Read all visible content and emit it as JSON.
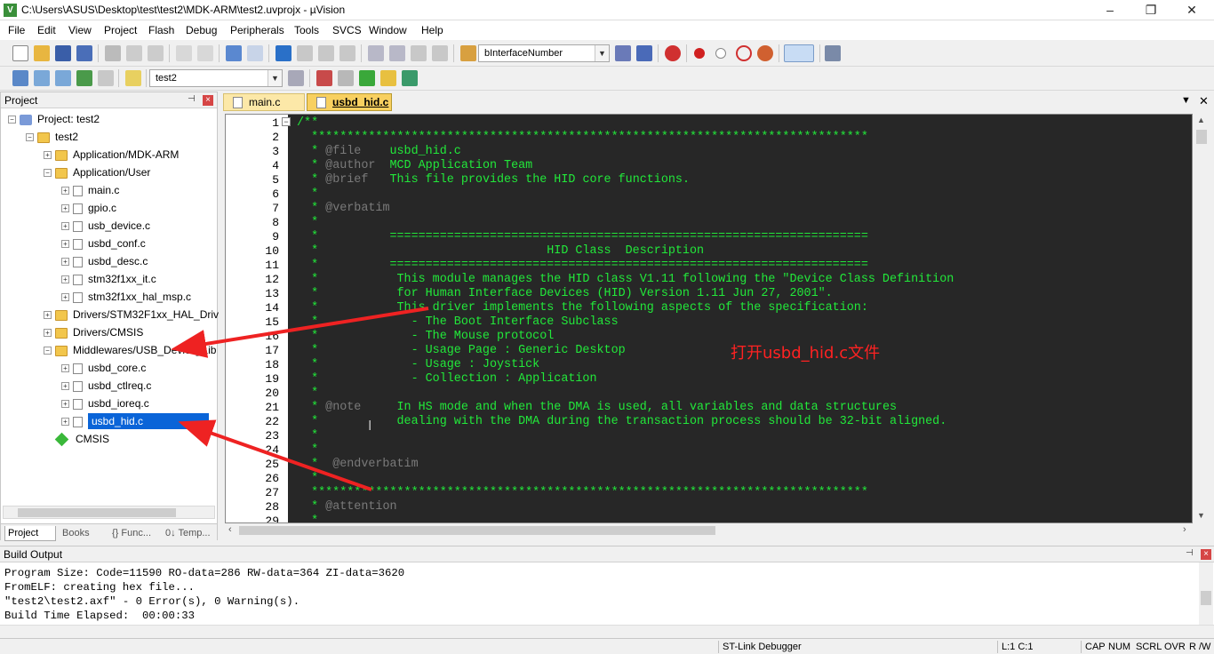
{
  "window": {
    "title": "C:\\Users\\ASUS\\Desktop\\test\\test2\\MDK-ARM\\test2.uvprojx - µVision",
    "app_icon": "V",
    "minimize": "–",
    "maximize": "❐",
    "close": "✕"
  },
  "menu": [
    "File",
    "Edit",
    "View",
    "Project",
    "Flash",
    "Debug",
    "Peripherals",
    "Tools",
    "SVCS",
    "Window",
    "Help"
  ],
  "toolbar1": {
    "find_combo": "bInterfaceNumber"
  },
  "toolbar2": {
    "target_combo": "test2"
  },
  "project_panel": {
    "title": "Project",
    "pin": "📌",
    "close": "×",
    "tree": [
      {
        "label": "Project: test2",
        "icon": "project-icon"
      },
      {
        "label": "test2",
        "icon": "folder-icon"
      },
      {
        "label": "Application/MDK-ARM",
        "icon": "folder-icon"
      },
      {
        "label": "Application/User",
        "icon": "folder-icon"
      },
      {
        "label": "main.c",
        "icon": "file-icon"
      },
      {
        "label": "gpio.c",
        "icon": "file-icon"
      },
      {
        "label": "usb_device.c",
        "icon": "file-icon"
      },
      {
        "label": "usbd_conf.c",
        "icon": "file-icon"
      },
      {
        "label": "usbd_desc.c",
        "icon": "file-icon"
      },
      {
        "label": "stm32f1xx_it.c",
        "icon": "file-icon"
      },
      {
        "label": "stm32f1xx_hal_msp.c",
        "icon": "file-icon"
      },
      {
        "label": "Drivers/STM32F1xx_HAL_Driv",
        "icon": "folder-icon"
      },
      {
        "label": "Drivers/CMSIS",
        "icon": "folder-icon"
      },
      {
        "label": "Middlewares/USB_Device_Lib",
        "icon": "folder-icon"
      },
      {
        "label": "usbd_core.c",
        "icon": "file-icon"
      },
      {
        "label": "usbd_ctlreq.c",
        "icon": "file-icon"
      },
      {
        "label": "usbd_ioreq.c",
        "icon": "file-icon"
      },
      {
        "label": "usbd_hid.c",
        "icon": "file-icon"
      },
      {
        "label": "CMSIS",
        "icon": "diamond-icon"
      }
    ],
    "bottom_tabs": [
      "Project",
      "Books",
      "{} Func...",
      "0↓ Temp..."
    ]
  },
  "editor": {
    "tabs": [
      "main.c",
      "usbd_hid.c"
    ],
    "active_tab": "usbd_hid.c",
    "line_numbers": [
      "1",
      "2",
      "3",
      "4",
      "5",
      "6",
      "7",
      "8",
      "9",
      "10",
      "11",
      "12",
      "13",
      "14",
      "15",
      "16",
      "17",
      "18",
      "19",
      "20",
      "21",
      "22",
      "23",
      "24",
      "25",
      "26",
      "27",
      "28",
      "29"
    ],
    "lines": [
      "/**",
      "  ******************************************************************************",
      "  * @file    usbd_hid.c",
      "  * @author  MCD Application Team",
      "  * @brief   This file provides the HID core functions.",
      "  *",
      "  * @verbatim",
      "  *",
      "  *          ===================================================================",
      "  *                                HID Class  Description",
      "  *          ===================================================================",
      "  *           This module manages the HID class V1.11 following the \"Device Class Definition",
      "  *           for Human Interface Devices (HID) Version 1.11 Jun 27, 2001\".",
      "  *           This driver implements the following aspects of the specification:",
      "  *             - The Boot Interface Subclass",
      "  *             - The Mouse protocol",
      "  *             - Usage Page : Generic Desktop",
      "  *             - Usage : Joystick",
      "  *             - Collection : Application",
      "  *",
      "  * @note     In HS mode and when the DMA is used, all variables and data structures",
      "  *           dealing with the DMA during the transaction process should be 32-bit aligned.",
      "  *",
      "  *",
      "  *  @endverbatim",
      "  *",
      "  ******************************************************************************",
      "  * @attention",
      "  *"
    ]
  },
  "annotation": "打开usbd_hid.c文件",
  "build_output": {
    "title": "Build Output",
    "lines": [
      "Program Size: Code=11590 RO-data=286 RW-data=364 ZI-data=3620",
      "FromELF: creating hex file...",
      "\"test2\\test2.axf\" - 0 Error(s), 0 Warning(s).",
      "Build Time Elapsed:  00:00:33"
    ]
  },
  "status": {
    "debugger": "ST-Link Debugger",
    "position": "L:1 C:1",
    "caps": "CAP",
    "num": "NUM",
    "scrl": "SCRL",
    "ovr": "OVR",
    "rw": "R /W"
  },
  "colors": {
    "code_bg": "#272727",
    "code_fg": "#22e83a",
    "doc_tag": "#7a7a7a",
    "selection": "#0a64d8",
    "annotation": "#ff2222"
  }
}
